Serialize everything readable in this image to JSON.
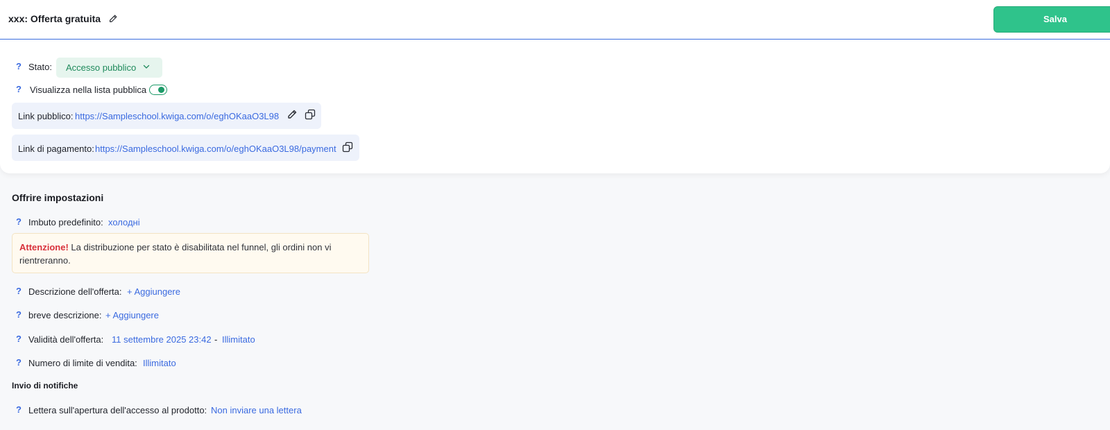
{
  "header": {
    "title": "xxx: Offerta gratuita",
    "save_label": "Salva"
  },
  "publish": {
    "status_label": "Stato:",
    "status_value": "Accesso pubblico",
    "public_list_label": "Visualizza nella lista pubblica",
    "public_list_enabled": true,
    "public_link_label": "Link pubblico:",
    "public_link_url": "https://Sampleschool.kwiga.com/o/eghOKaaO3L98",
    "payment_link_label": "Link di pagamento:",
    "payment_link_url": "https://Sampleschool.kwiga.com/o/eghOKaaO3L98/payment"
  },
  "settings": {
    "title": "Offrire impostazioni",
    "funnel_label": "Imbuto predefinito:",
    "funnel_value": "холодні",
    "alert_strong": "Attenzione!",
    "alert_text": "La distribuzione per stato è disabilitata nel funnel, gli ordini non vi rientreranno.",
    "description_label": "Descrizione dell'offerta:",
    "description_action": "+ Aggiungere",
    "short_description_label": "breve descrizione:",
    "short_description_action": "+ Aggiungere",
    "validity_label": "Validità dell'offerta:",
    "validity_start": "11 settembre 2025 23:42",
    "validity_separator": "-",
    "validity_end": "Illimitato",
    "sales_limit_label": "Numero di limite di vendita:",
    "sales_limit_value": "Illimitato"
  },
  "notifications": {
    "title": "Invio di notifiche",
    "access_letter_label": "Lettera sull'apertura dell'accesso al prodotto:",
    "access_letter_value": "Non inviare una lettera"
  },
  "help_mark": "?",
  "icons": {
    "edit": "pencil-icon",
    "copy": "copy-icon",
    "chevron": "chevron-down-icon"
  },
  "colors": {
    "accent": "#3a6ae0",
    "save": "#2fc38b",
    "status_bg": "#e6f5ee",
    "status_text": "#1f8a5c",
    "warning": "#d8323c"
  }
}
